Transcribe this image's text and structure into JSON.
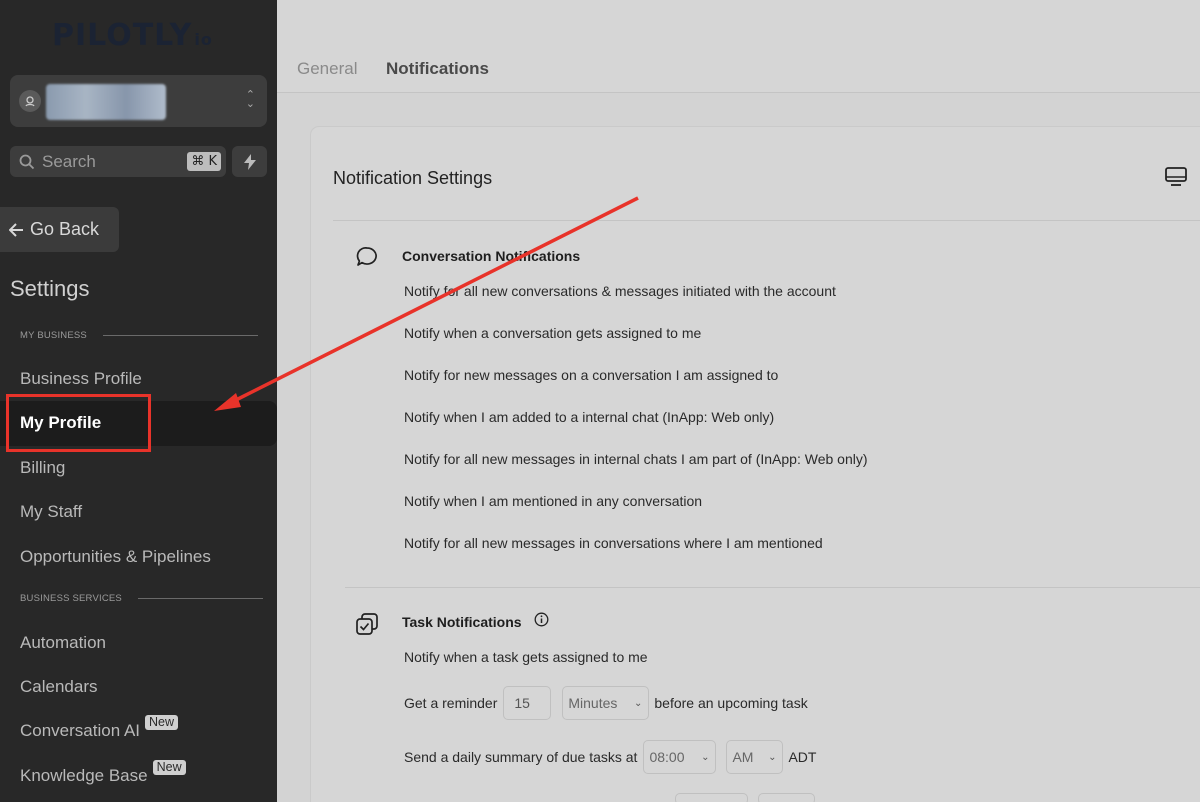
{
  "sidebar": {
    "logo": "PILOTLY",
    "logo_suffix": "io",
    "search_placeholder": "Search",
    "search_shortcut": "⌘ K",
    "go_back": "Go Back",
    "settings_title": "Settings",
    "section_my_business": "MY BUSINESS",
    "section_business_services": "BUSINESS SERVICES",
    "items": [
      {
        "label": "Business Profile"
      },
      {
        "label": "My Profile",
        "active": true
      },
      {
        "label": "Billing"
      },
      {
        "label": "My Staff"
      },
      {
        "label": "Opportunities & Pipelines"
      },
      {
        "label": "Automation"
      },
      {
        "label": "Calendars"
      },
      {
        "label": "Conversation AI",
        "badge": "New"
      },
      {
        "label": "Knowledge Base",
        "badge": "New"
      }
    ]
  },
  "tabs": [
    {
      "label": "General"
    },
    {
      "label": "Notifications",
      "active": true
    }
  ],
  "card": {
    "title": "Notification Settings",
    "conversation": {
      "title": "Conversation Notifications",
      "options": [
        "Notify for all new conversations & messages initiated with the account",
        "Notify when a conversation gets assigned to me",
        "Notify for new messages on a conversation I am assigned to",
        "Notify when I am added to a internal chat (InApp: Web only)",
        "Notify for all new messages in internal chats I am part of (InApp: Web only)",
        "Notify when I am mentioned in any conversation",
        "Notify for all new messages in conversations where I am mentioned"
      ]
    },
    "task": {
      "title": "Task Notifications",
      "assigned": "Notify when a task gets assigned to me",
      "reminder_prefix": "Get a reminder",
      "reminder_value": "15",
      "reminder_unit": "Minutes",
      "reminder_suffix": "before an upcoming task",
      "summary_prefix": "Send a daily summary of due tasks at",
      "summary_time": "08:00",
      "summary_ampm": "AM",
      "summary_tz": "ADT"
    }
  },
  "colors": {
    "sidebar_bg": "#282828",
    "main_bg": "#d6d6d6",
    "annotation": "#e8332a"
  }
}
